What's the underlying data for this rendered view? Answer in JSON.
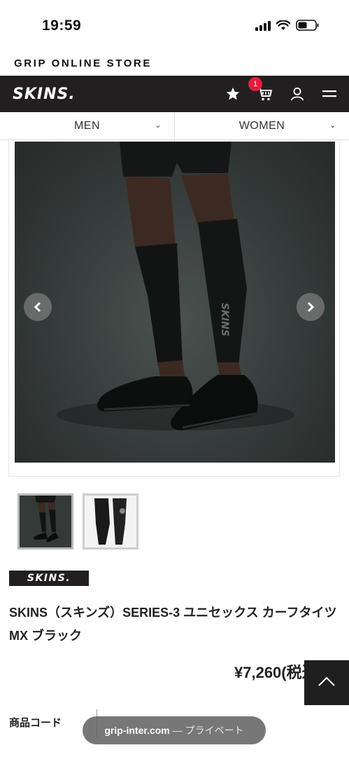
{
  "status_bar": {
    "time": "19:59",
    "icons": [
      "signal-icon",
      "wifi-icon",
      "battery-icon"
    ]
  },
  "store": {
    "title": "GRIP ONLINE STORE"
  },
  "header": {
    "logo_text": "SKINS.",
    "icons": [
      "star-icon",
      "cart-icon",
      "user-icon",
      "menu-icon"
    ],
    "cart_count": "1",
    "background": "#231f20",
    "badge_color": "#e01e3c"
  },
  "categories": [
    {
      "label": "MEN",
      "icon": "chevron-down-icon"
    },
    {
      "label": "WOMEN",
      "icon": "chevron-down-icon"
    }
  ],
  "gallery": {
    "prev_icon": "chevron-left-icon",
    "next_icon": "chevron-right-icon",
    "thumbnails": 2
  },
  "product": {
    "brand_badge": "SKINS.",
    "title": "SKINS（スキンズ）SERIES-3 ユニセックス カーフタイツMX ブラック",
    "price": "¥7,260(税込)"
  },
  "spec": {
    "code_label": "商品コード"
  },
  "browser": {
    "url_domain": "grip-inter.com",
    "url_mode": "— プライベート"
  },
  "back_to_top_icon": "chevron-up-icon"
}
